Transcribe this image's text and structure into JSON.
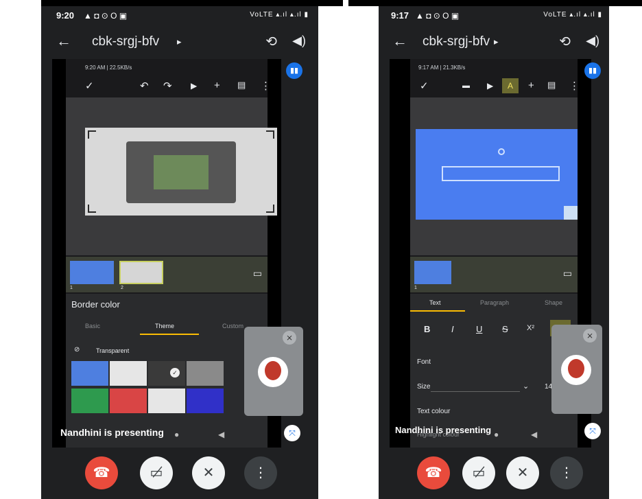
{
  "left": {
    "status": {
      "time": "9:20",
      "indicators": "▲ ◘ ⊙ O ▣",
      "right": "VoLTE ▴.ıl ▴.ıl ▮"
    },
    "meeting": {
      "code": "cbk-srgj-bfv",
      "caret": "▸"
    },
    "shared": {
      "status_time": "9:20 AM | 22.5KB/s",
      "toolbar_icons": [
        "check-icon",
        "undo-icon",
        "redo-icon",
        "play-icon",
        "add-icon",
        "comment-icon",
        "more-icon"
      ],
      "slide_numbers": [
        "1",
        "2"
      ],
      "panel_title": "Border color",
      "tabs": [
        "Basic",
        "Theme",
        "Custom"
      ],
      "active_tab": "Theme",
      "transparent_label": "Transparent",
      "colors": [
        "#4e7fe0",
        "#e6e6e6",
        "#3a3a3a",
        "#8a8a8a",
        "#2f86d6",
        "#2e9a4e",
        "#d94545",
        "#e6e6e6",
        "#3030c8",
        "#e0a020"
      ]
    },
    "presenting": "Nandhini is presenting"
  },
  "right": {
    "status": {
      "time": "9:17",
      "indicators": "▲ ◘ ⊙ O ▣",
      "right": "VoLTE ▴.ıl ▴.ıl ▮"
    },
    "meeting": {
      "code": "cbk-srgj-bfv",
      "caret": "▸"
    },
    "shared": {
      "status_time": "9:17 AM | 21.3KB/s",
      "toolbar_icons": [
        "check-icon",
        "format-icon",
        "play-icon",
        "text-format-icon",
        "add-icon",
        "comment-icon",
        "more-icon"
      ],
      "slide_number": "1",
      "tabs": [
        "Text",
        "Paragraph",
        "Shape"
      ],
      "active_tab": "Text",
      "format_buttons": [
        "B",
        "I",
        "U",
        "S",
        "X²",
        "X₂"
      ],
      "rows": {
        "font": "Font",
        "size": "Size",
        "size_value": "14",
        "text_colour": "Text colour",
        "highlight": "Highlight colour"
      }
    },
    "presenting": "Nandhini is presenting"
  },
  "colors": {
    "end_call": "#e94b3c",
    "accent": "#1a73e8",
    "theme_underline": "#fbbc04"
  }
}
